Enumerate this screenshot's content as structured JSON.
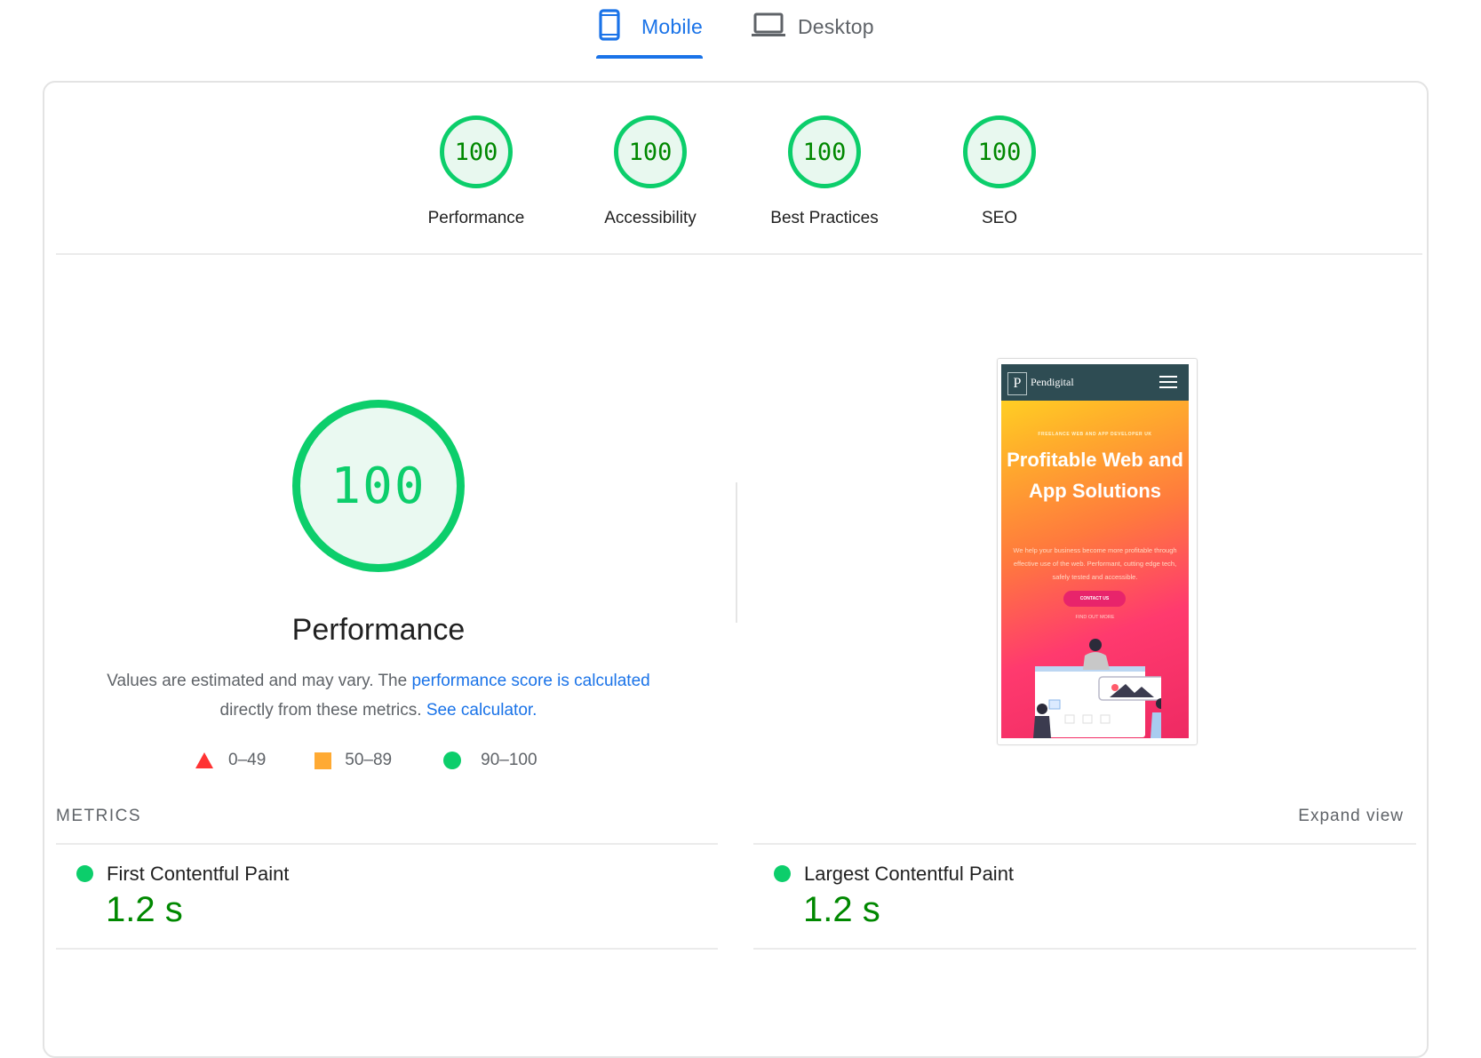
{
  "tabs": [
    {
      "label": "Mobile",
      "icon": "phone-icon",
      "active": true
    },
    {
      "label": "Desktop",
      "icon": "laptop-icon",
      "active": false
    }
  ],
  "colors": {
    "accent": "#1a73e8",
    "pass": "#0cce6b",
    "pass_text": "#008800",
    "average": "#ffaa33",
    "fail": "#ff3333"
  },
  "category_scores": [
    {
      "label": "Performance",
      "score": "100"
    },
    {
      "label": "Accessibility",
      "score": "100"
    },
    {
      "label": "Best Practices",
      "score": "100"
    },
    {
      "label": "SEO",
      "score": "100"
    }
  ],
  "performance": {
    "score": "100",
    "title": "Performance",
    "desc_prefix": "Values are estimated and may vary. The ",
    "desc_link1": "performance score is calculated",
    "desc_middle": " directly from these metrics. ",
    "desc_link2": "See calculator."
  },
  "legend": [
    {
      "shape": "triangle",
      "range": "0–49"
    },
    {
      "shape": "square",
      "range": "50–89"
    },
    {
      "shape": "circle",
      "range": "90–100"
    }
  ],
  "screenshot": {
    "brand_initial": "P",
    "brand": "Pendigital",
    "kicker": "FREELANCE WEB AND APP DEVELOPER UK",
    "headline": "Profitable Web and App Solutions",
    "body": "We help your business become more profitable through effective use of the web. Performant, cutting edge tech, safely tested and accessible.",
    "cta": "CONTACT US",
    "secondary": "FIND OUT MORE"
  },
  "metrics": {
    "title": "METRICS",
    "expand_label": "Expand view",
    "items": [
      {
        "label": "First Contentful Paint",
        "value": "1.2 s",
        "status": "pass"
      },
      {
        "label": "Largest Contentful Paint",
        "value": "1.2 s",
        "status": "pass"
      }
    ]
  }
}
